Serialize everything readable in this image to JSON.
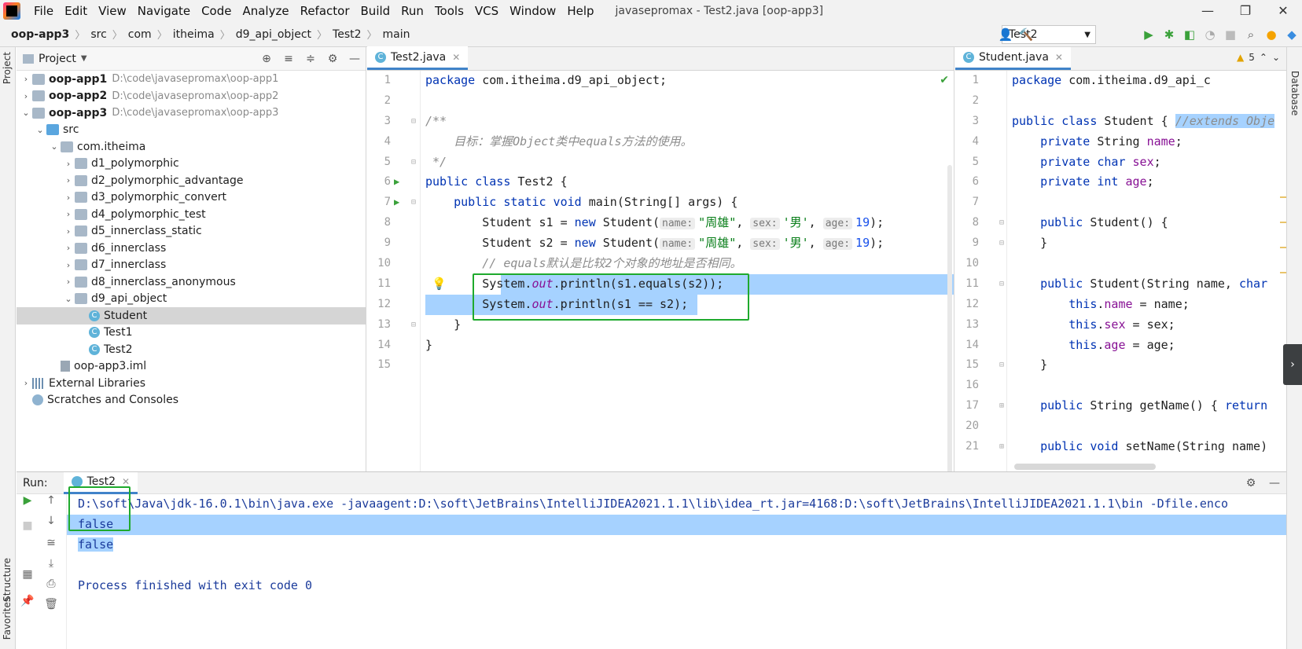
{
  "window": {
    "menu": [
      "File",
      "Edit",
      "View",
      "Navigate",
      "Code",
      "Analyze",
      "Refactor",
      "Build",
      "Run",
      "Tools",
      "VCS",
      "Window",
      "Help"
    ],
    "title": "javasepromax - Test2.java [oop-app3]",
    "controls": [
      "—",
      "❐",
      "✕"
    ]
  },
  "breadcrumb": [
    "oop-app3",
    "src",
    "com",
    "itheima",
    "d9_api_object",
    "Test2",
    "main"
  ],
  "toolbar": {
    "run_config": "Test2"
  },
  "left_strip": {
    "project_tab": "Project",
    "structure_tab": "Structure",
    "favorites_tab": "Favorites"
  },
  "right_strip": {
    "database_tab": "Database"
  },
  "project": {
    "title": "Project",
    "nodes": [
      {
        "label": "oop-app1",
        "path": "D:\\code\\javasepromax\\oop-app1"
      },
      {
        "label": "oop-app2",
        "path": "D:\\code\\javasepromax\\oop-app2"
      },
      {
        "label": "oop-app3",
        "path": "D:\\code\\javasepromax\\oop-app3"
      },
      {
        "label": "src"
      },
      {
        "label": "com.itheima"
      },
      {
        "label": "d1_polymorphic"
      },
      {
        "label": "d2_polymorphic_advantage"
      },
      {
        "label": "d3_polymorphic_convert"
      },
      {
        "label": "d4_polymorphic_test"
      },
      {
        "label": "d5_innerclass_static"
      },
      {
        "label": "d6_innerclass"
      },
      {
        "label": "d7_innerclass"
      },
      {
        "label": "d8_innerclass_anonymous"
      },
      {
        "label": "d9_api_object"
      },
      {
        "label": "Student"
      },
      {
        "label": "Test1"
      },
      {
        "label": "Test2"
      },
      {
        "label": "oop-app3.iml"
      },
      {
        "label": "External Libraries"
      },
      {
        "label": "Scratches and Consoles"
      }
    ]
  },
  "editor1": {
    "tab": "Test2.java",
    "line_numbers": [
      "1",
      "2",
      "3",
      "4",
      "5",
      "6",
      "7",
      "8",
      "9",
      "10",
      "11",
      "12",
      "13",
      "14",
      "15"
    ],
    "code": {
      "l1_kw": "package",
      "l1_rest": " com.itheima.d9_api_object;",
      "l3": "/**",
      "l4": "    目标：掌握Object类中equals方法的使用。",
      "l5": " */",
      "l6_kw": "public class",
      "l6_rest": " Test2 {",
      "l7_kw": "public static void",
      "l7_rest": " main(String[] args) {",
      "l8_a": "Student s1 = ",
      "l8_new": "new",
      "l8_b": " Student(",
      "hint_name": "name:",
      "hint_sex": "sex:",
      "hint_age": "age:",
      "str_name": "\"周雄\"",
      "str_sex": "'男'",
      "num_age": "19",
      "comma": ", ",
      "close": ");",
      "l9_a": "Student s2 = ",
      "l10": "// equals默认是比较2个对象的地址是否相同。",
      "sys": "System.",
      "out": "out",
      "l11_rest": ".println(s1.equals(s2));",
      "l12_rest": ".println(s1 == s2);",
      "l13": "}",
      "l14": "}"
    }
  },
  "editor2": {
    "tab": "Student.java",
    "warnings": "5",
    "line_numbers": [
      "1",
      "2",
      "3",
      "4",
      "5",
      "6",
      "7",
      "8",
      "9",
      "10",
      "11",
      "12",
      "13",
      "14",
      "15",
      "16",
      "17",
      "20",
      "21"
    ],
    "code": {
      "l1_kw": "package",
      "l1_rest": " com.itheima.d9_api_c",
      "l3_kw": "public class",
      "l3_rest": " Student { ",
      "l3_cm": "//extends Obje",
      "private": "private",
      "string": " String ",
      "char": "char",
      "int": "int",
      "name": "name",
      "sex": "sex",
      "age": "age",
      "semi": ";",
      "public": "public",
      "l8_rest": " Student() {",
      "l9": "}",
      "l11_rest": " Student(String name, ",
      "l11_char": "char",
      "this": "this",
      "l12_rest": " = name;",
      "l13_rest": " = sex;",
      "l14_rest": " = age;",
      "l15": "}",
      "l17_rest": " String getName() { ",
      "return": "return",
      "l21_kw": "void",
      "l21_rest": " setName(String name) "
    }
  },
  "run": {
    "label": "Run:",
    "tab": "Test2",
    "lines": [
      "D:\\soft\\Java\\jdk-16.0.1\\bin\\java.exe -javaagent:D:\\soft\\JetBrains\\IntelliJIDEA2021.1.1\\lib\\idea_rt.jar=4168:D:\\soft\\JetBrains\\IntelliJIDEA2021.1.1\\bin -Dfile.enco",
      "false",
      "false",
      "",
      "Process finished with exit code 0"
    ]
  }
}
